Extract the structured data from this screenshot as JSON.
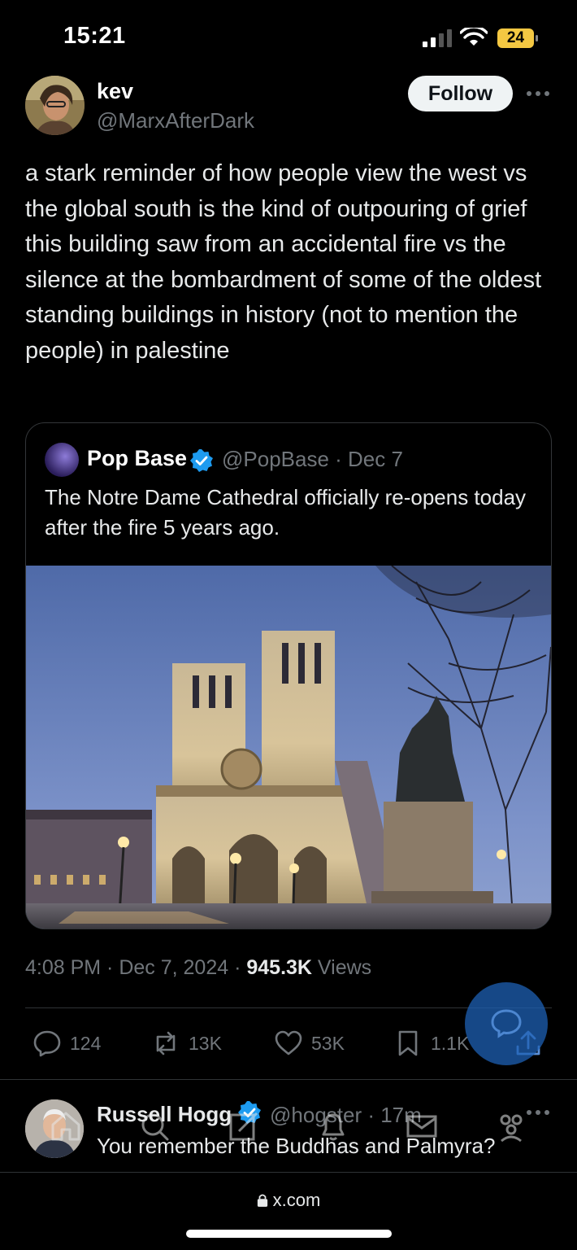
{
  "status_bar": {
    "time": "15:21",
    "battery": "24"
  },
  "author": {
    "name": "kev",
    "handle": "@MarxAfterDark"
  },
  "follow_label": "Follow",
  "tweet_text": "a stark reminder of how people view the west vs the global south is the kind of outpouring of grief this building saw from an accidental fire vs the silence at the bombardment of some of the oldest standing buildings in history (not to mention the people) in palestine",
  "quote": {
    "name": "Pop Base",
    "meta": "@PopBase · Dec 7",
    "text": "The Notre Dame Cathedral officially re-opens today after the fire 5 years ago."
  },
  "timestamp": "4:08 PM · Dec 7, 2024 · ",
  "views_count": "945.3K",
  "views_label": " Views",
  "actions": {
    "replies": "124",
    "reposts": "13K",
    "likes": "53K",
    "bookmarks": "1.1K"
  },
  "reply": {
    "name": "Russell Hogg",
    "meta": "@hogster · 17m",
    "text": "You remember the Buddhas and Palmyra?"
  },
  "browser": {
    "url": "x.com"
  },
  "colors": {
    "accent": "#1d9bf0",
    "muted": "#71767b",
    "background": "#000000"
  }
}
